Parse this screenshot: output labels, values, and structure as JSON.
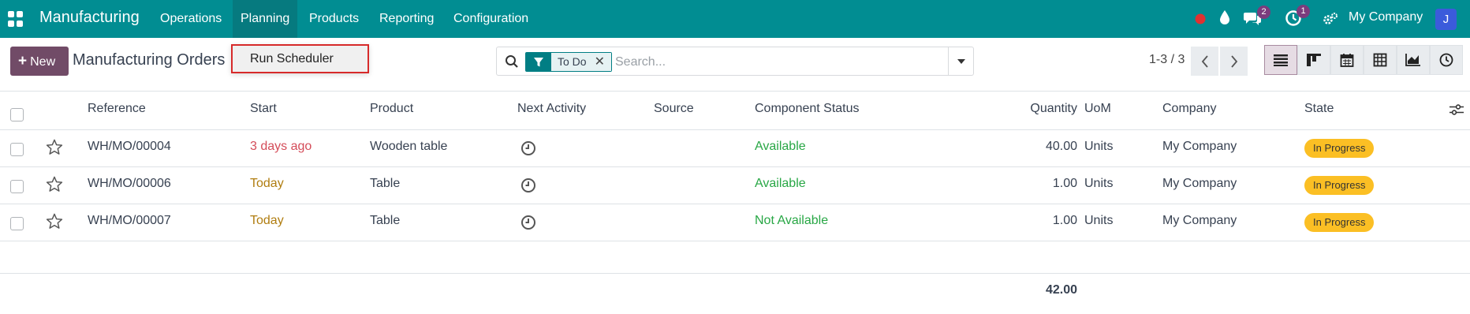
{
  "navbar": {
    "app_name": "Manufacturing",
    "menus": [
      "Operations",
      "Planning",
      "Products",
      "Reporting",
      "Configuration"
    ],
    "active_menu": "Planning",
    "messages_count": "2",
    "activities_count": "1",
    "company": "My Company",
    "user_initial": "J",
    "colors": {
      "navbar": "#018d92",
      "badge": "#7b3c7d",
      "status_dot": "#e03131"
    }
  },
  "control_panel": {
    "new_label": "New",
    "title": "Manufacturing Orders",
    "dropdown_item": "Run Scheduler",
    "search": {
      "facet_label": "To Do",
      "placeholder": "Search..."
    },
    "pager": "1-3 / 3",
    "views": [
      "list-icon",
      "kanban-icon",
      "calendar-icon",
      "pivot-icon",
      "graph-icon",
      "activity-icon"
    ],
    "active_view": "list-icon"
  },
  "table": {
    "columns": {
      "reference": "Reference",
      "start": "Start",
      "product": "Product",
      "next_activity": "Next Activity",
      "source": "Source",
      "component_status": "Component Status",
      "quantity": "Quantity",
      "uom": "UoM",
      "company": "Company",
      "state": "State"
    },
    "rows": [
      {
        "reference": "WH/MO/00004",
        "start": "3 days ago",
        "start_status": "late",
        "product": "Wooden table",
        "source": "",
        "component_status": "Available",
        "quantity": "40.00",
        "uom": "Units",
        "company": "My Company",
        "state": "In Progress"
      },
      {
        "reference": "WH/MO/00006",
        "start": "Today",
        "start_status": "today",
        "product": "Table",
        "source": "",
        "component_status": "Available",
        "quantity": "1.00",
        "uom": "Units",
        "company": "My Company",
        "state": "In Progress"
      },
      {
        "reference": "WH/MO/00007",
        "start": "Today",
        "start_status": "today",
        "product": "Table",
        "source": "",
        "component_status": "Not Available",
        "quantity": "1.00",
        "uom": "Units",
        "company": "My Company",
        "state": "In Progress"
      }
    ],
    "total_quantity": "42.00"
  }
}
